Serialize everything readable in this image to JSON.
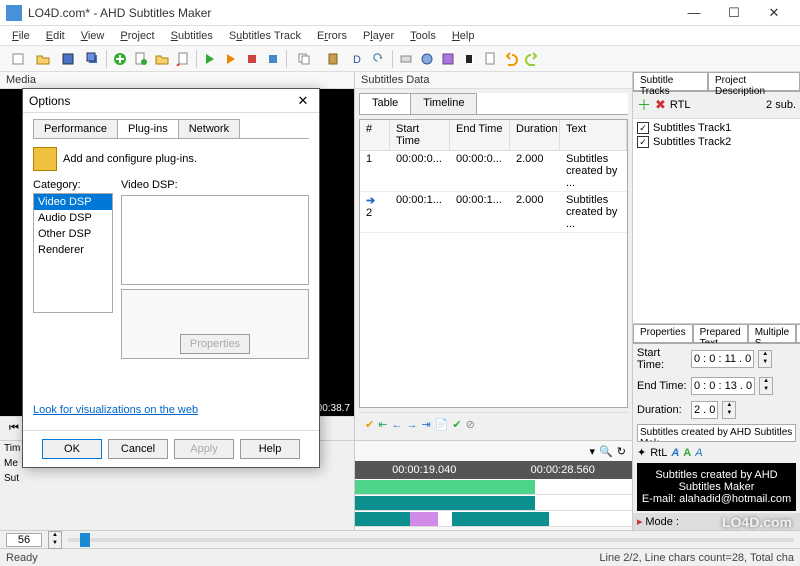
{
  "window": {
    "title": "LO4D.com* - AHD Subtitles Maker"
  },
  "menubar": [
    "File",
    "Edit",
    "View",
    "Project",
    "Subtitles",
    "Subtitles Track",
    "Errors",
    "Player",
    "Tools",
    "Help"
  ],
  "panes": {
    "media": "Media",
    "sub_data": "Subtitles Data",
    "tracks_tabs": [
      "Subtitle Tracks",
      "Project Description"
    ],
    "timeline_sidebar": [
      "Tim",
      "Me",
      "Sut"
    ]
  },
  "sub_tabs": [
    "Table",
    "Timeline"
  ],
  "table": {
    "headers": {
      "idx": "#",
      "st": "Start Time",
      "et": "End Time",
      "dur": "Duration",
      "txt": "Text"
    },
    "rows": [
      {
        "idx": "1",
        "st": "00:00:0...",
        "et": "00:00:0...",
        "dur": "2.000",
        "txt": "Subtitles created by ..."
      },
      {
        "idx": "2",
        "st": "00:00:1...",
        "et": "00:00:1...",
        "dur": "2.000",
        "txt": "Subtitles created by ..."
      }
    ]
  },
  "tracks": {
    "rtl_label": "RTL",
    "count": "2 sub.",
    "items": [
      "Subtitles Track1",
      "Subtitles Track2"
    ]
  },
  "properties": {
    "tabs": [
      "Properties",
      "Prepared Text",
      "Multiple S"
    ],
    "start_label": "Start Time:",
    "end_label": "End Time:",
    "dur_label": "Duration:",
    "start_value": "0 : 0 : 11 . 0",
    "end_value": "0 : 0 : 13 . 0",
    "dur_value": "2 . 0",
    "subtitle_text": "Subtitles created by AHD Subtitles Mak",
    "rtl": "RtL"
  },
  "preview": {
    "line1": "Subtitles created by AHD Subtitles Maker",
    "line2": "E-mail: alahadid@hotmail.com",
    "mode": "Mode :"
  },
  "timeline": {
    "t1": "00:00:19.040",
    "t2": "00:00:28.560"
  },
  "media_time": "00:00:38.7",
  "zoom": {
    "value": "56"
  },
  "status": {
    "left": "Ready",
    "right": "Line 2/2, Line chars count=28, Total cha"
  },
  "dialog": {
    "title": "Options",
    "tabs": [
      "Performance",
      "Plug-ins",
      "Network"
    ],
    "desc": "Add and configure plug-ins.",
    "cat_label": "Category:",
    "dsp_label": "Video DSP:",
    "categories": [
      "Video DSP",
      "Audio DSP",
      "Other DSP",
      "Renderer"
    ],
    "props_btn": "Properties",
    "link": "Look for visualizations on the web",
    "buttons": {
      "ok": "OK",
      "cancel": "Cancel",
      "apply": "Apply",
      "help": "Help"
    }
  },
  "watermark": "LO4D.com"
}
